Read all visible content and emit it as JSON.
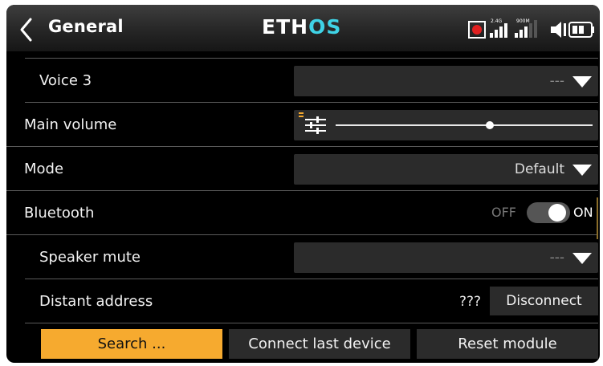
{
  "header": {
    "title": "General",
    "logo_main": "ETH",
    "logo_accent": "OS",
    "signal_band_1": "2.4G",
    "signal_band_2": "900M"
  },
  "rows": {
    "voice3": {
      "label": "Voice 3",
      "value": "---"
    },
    "main_volume": {
      "label": "Main volume",
      "level_fraction": 0.6
    },
    "mode": {
      "label": "Mode",
      "value": "Default"
    },
    "bluetooth": {
      "label": "Bluetooth",
      "off_label": "OFF",
      "on_label": "ON",
      "state": "on"
    },
    "speaker_mute": {
      "label": "Speaker mute",
      "value": "---"
    },
    "distant_address": {
      "label": "Distant address",
      "address": "???",
      "action_label": "Disconnect"
    }
  },
  "buttons": {
    "search": "Search ...",
    "connect_last": "Connect last device",
    "reset_module": "Reset module"
  },
  "colors": {
    "accent": "#f6aa2f",
    "logo_accent": "#3fd3e6",
    "background": "#000000",
    "control_bg": "#2b2b2b"
  },
  "icons": {
    "back": "chevron-left-icon",
    "slider_settings": "sliders-icon",
    "record": "record-icon",
    "speaker": "speaker-icon",
    "battery": "battery-icon"
  }
}
